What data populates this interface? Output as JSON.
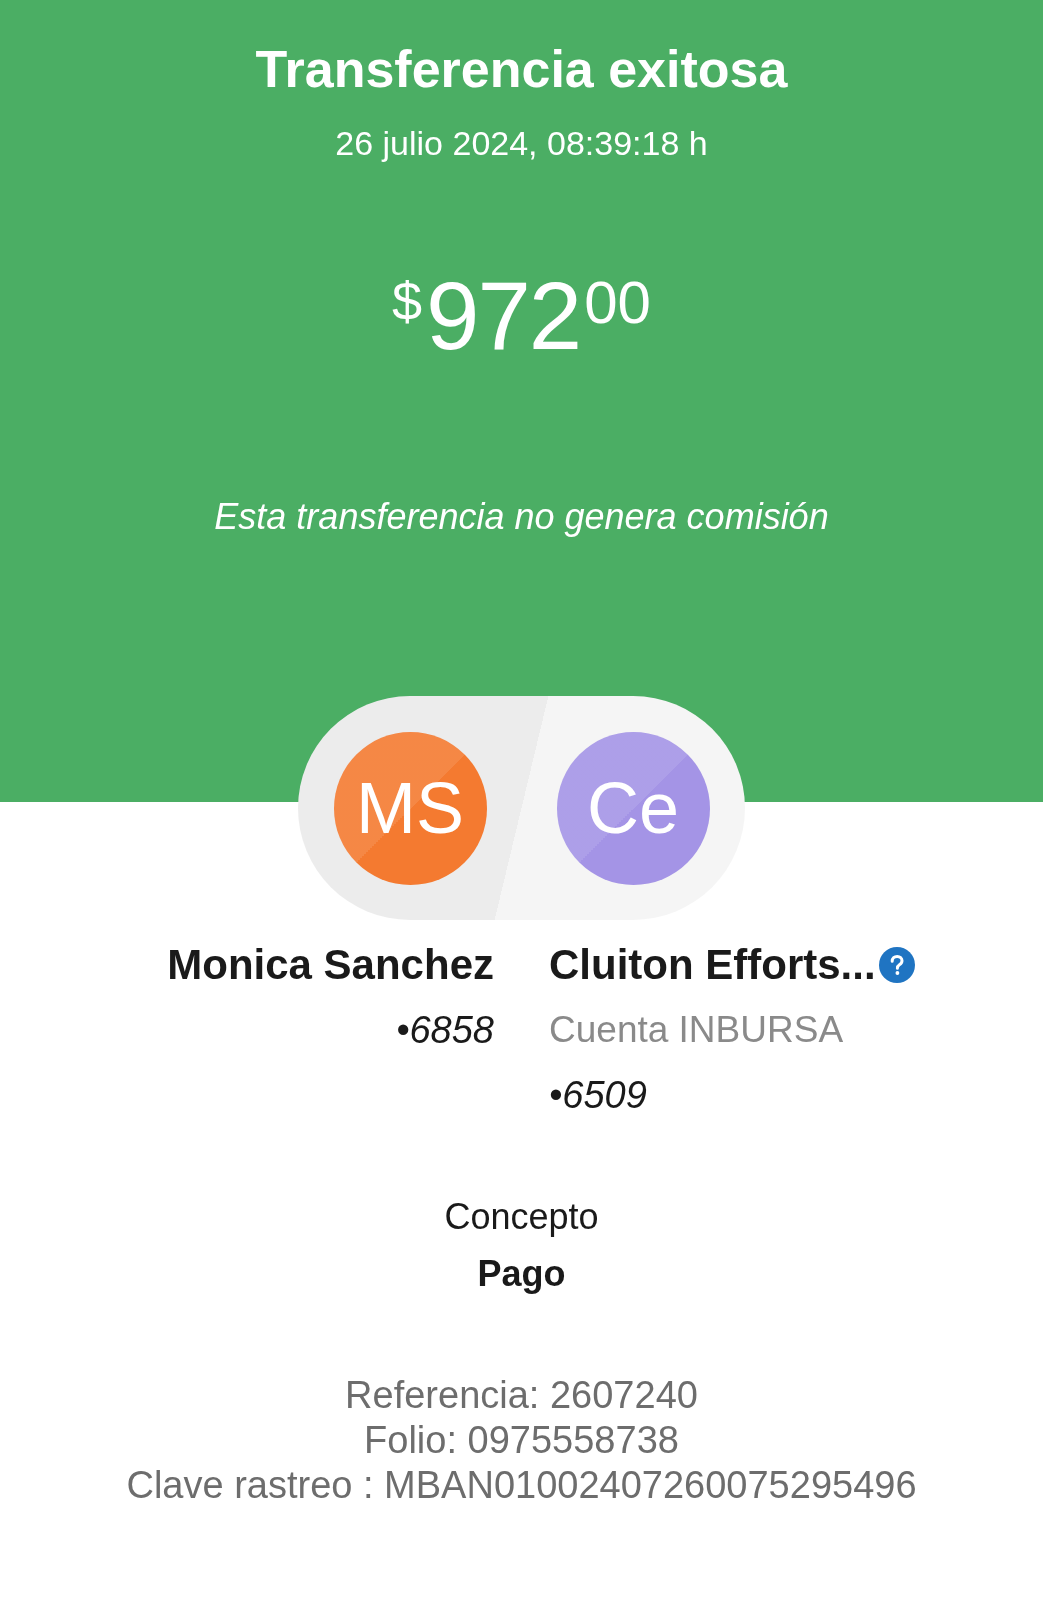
{
  "header": {
    "title": "Transferencia exitosa",
    "datetime": "26 julio 2024, 08:39:18 h",
    "amount": {
      "currency": "$",
      "integer": "972",
      "cents": "00"
    },
    "note": "Esta transferencia no genera comisión"
  },
  "parties": [
    {
      "kind": "sender",
      "initials": "MS",
      "color": "#f47a30",
      "name": "Monica Sanchez",
      "account": "•6858"
    },
    {
      "kind": "recipient",
      "initials": "Ce",
      "color": "#a494e6",
      "name": "Cluiton Efforts...",
      "bank": "Cuenta INBURSA",
      "account": "•6509"
    }
  ],
  "concept": {
    "label": "Concepto",
    "value": "Pago"
  },
  "references": [
    "Referencia: 2607240",
    "Folio: 0975558738",
    "Clave rastreo : MBAN01002407260075295496"
  ]
}
